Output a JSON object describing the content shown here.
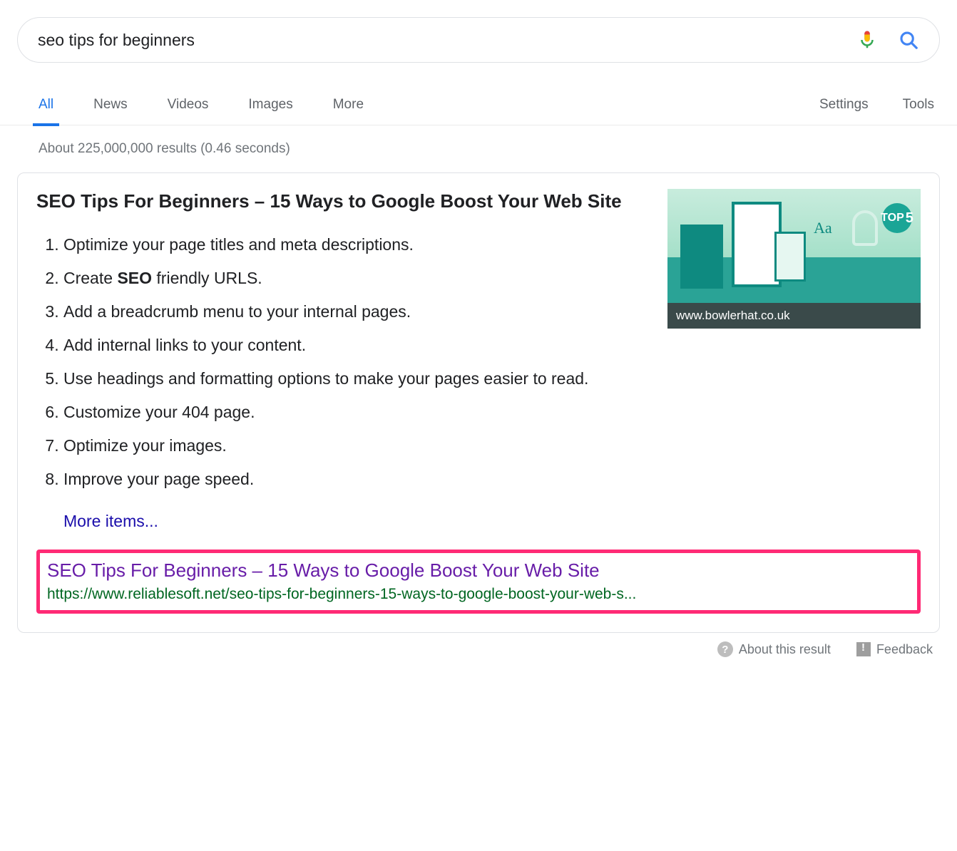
{
  "search": {
    "query": "seo tips for beginners"
  },
  "tabs": {
    "items": [
      "All",
      "News",
      "Videos",
      "Images",
      "More"
    ],
    "active_index": 0,
    "right": [
      "Settings",
      "Tools"
    ]
  },
  "stats": "About 225,000,000 results (0.46 seconds)",
  "snippet": {
    "title": "SEO Tips For Beginners – 15 Ways to Google Boost Your Web Site",
    "list_prefix_bold_index": 1,
    "items": [
      {
        "text": "Optimize your page titles and meta descriptions."
      },
      {
        "text_pre": "Create ",
        "bold": "SEO",
        "text_post": " friendly URLS."
      },
      {
        "text": "Add a breadcrumb menu to your internal pages."
      },
      {
        "text": "Add internal links to your content."
      },
      {
        "text": "Use headings and formatting options to make your pages easier to read."
      },
      {
        "text": "Customize your 404 page."
      },
      {
        "text": "Optimize your images."
      },
      {
        "text": "Improve your page speed."
      }
    ],
    "more": "More items...",
    "thumb_caption": "www.bowlerhat.co.uk",
    "thumb_badge": "5",
    "thumb_aa": "Aa"
  },
  "result": {
    "title": "SEO Tips For Beginners – 15 Ways to Google Boost Your Web Site",
    "url": "https://www.reliablesoft.net/seo-tips-for-beginners-15-ways-to-google-boost-your-web-s..."
  },
  "footer": {
    "about": "About this result",
    "feedback": "Feedback"
  },
  "colors": {
    "accent": "#1a73e8",
    "link": "#1a0dab",
    "visited": "#681da8",
    "url_green": "#006621",
    "highlight_box": "#ff2a75"
  }
}
